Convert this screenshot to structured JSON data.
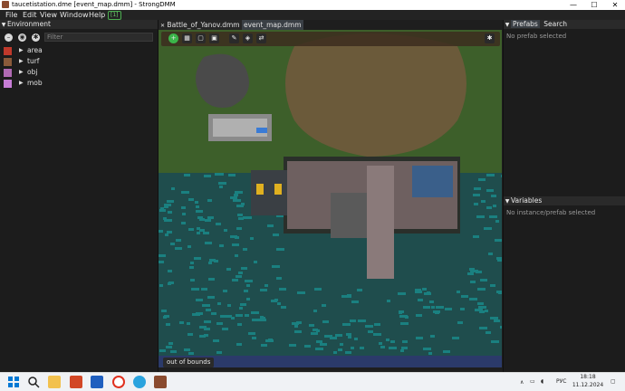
{
  "window": {
    "title": "taucetistation.dme [event_map.dmm] - StrongDMM",
    "minimize": "—",
    "maximize": "☐",
    "close": "✕"
  },
  "menu": {
    "items": [
      "File",
      "Edit",
      "View",
      "Window",
      "Help"
    ],
    "badge": "[1]"
  },
  "environment": {
    "header": "Environment",
    "filter_placeholder": "Filter",
    "tree": [
      {
        "label": "area",
        "icon_color": "#c0392b"
      },
      {
        "label": "turf",
        "icon_color": "#8a5a3a"
      },
      {
        "label": "obj",
        "icon_color": "#b06ab3"
      },
      {
        "label": "mob",
        "icon_color": "#c77dd6"
      }
    ]
  },
  "tabs": [
    {
      "label": "Battle_of_Yanov.dmm",
      "active": false
    },
    {
      "label": "event_map.dmm",
      "active": true
    }
  ],
  "map_toolbar": {
    "icons": [
      "add-icon",
      "grid-icon",
      "select-icon",
      "fill-icon",
      "pencil-icon",
      "eraser-icon",
      "swap-icon",
      "settings-icon"
    ]
  },
  "status": {
    "text": "out of bounds"
  },
  "prefabs": {
    "tabs": [
      "Prefabs",
      "Search"
    ],
    "empty": "No prefab selected"
  },
  "variables": {
    "header": "Variables",
    "empty": "No instance/prefab selected"
  },
  "taskbar": {
    "lang": "РУС",
    "time": "18:18",
    "date": "11.12.2024"
  },
  "colors": {
    "accent_green": "#3bb54a",
    "water_teal": "#1a7a7a",
    "sand": "#6b5a3a",
    "grass": "#3d5f2a"
  }
}
